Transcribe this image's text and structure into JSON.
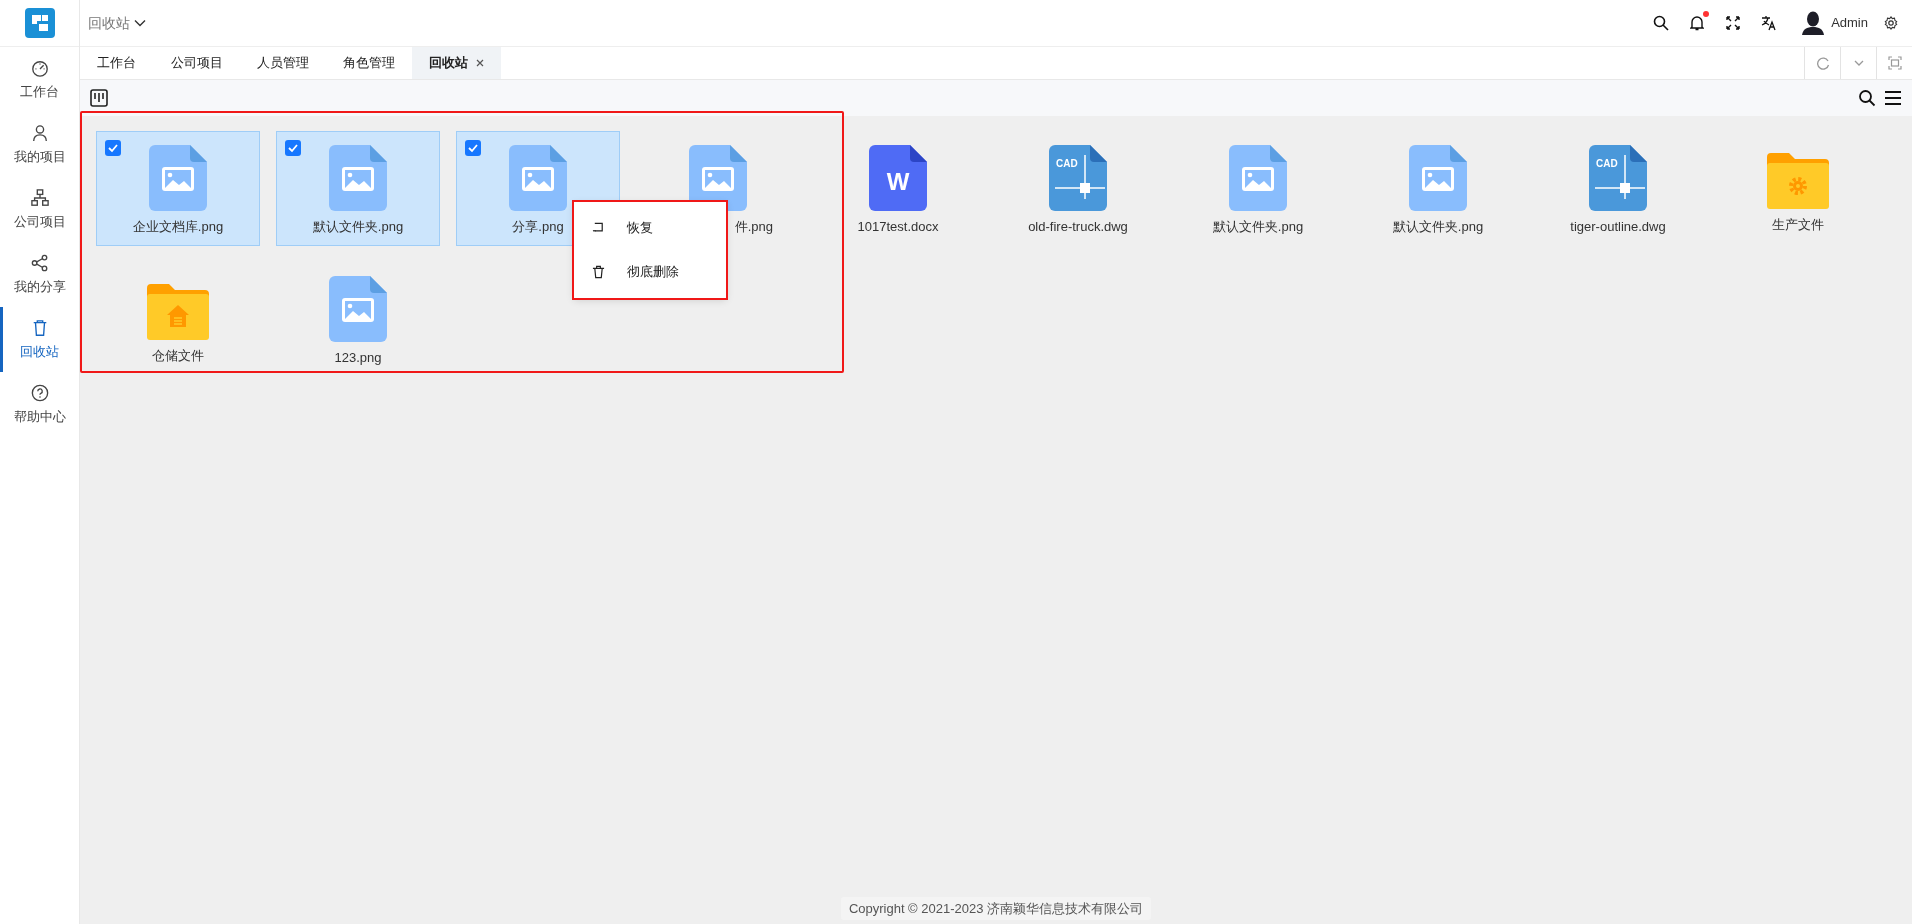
{
  "breadcrumb": {
    "label": "回收站"
  },
  "header": {
    "notification_dot": true,
    "user": "Admin"
  },
  "sidebar": {
    "items": [
      {
        "label": "工作台",
        "selected": false
      },
      {
        "label": "我的项目",
        "selected": false
      },
      {
        "label": "公司项目",
        "selected": false
      },
      {
        "label": "我的分享",
        "selected": false
      },
      {
        "label": "回收站",
        "selected": true
      },
      {
        "label": "帮助中心",
        "selected": false
      }
    ]
  },
  "tabs": [
    {
      "label": "工作台",
      "selected": false,
      "closable": false
    },
    {
      "label": "公司项目",
      "selected": false,
      "closable": false
    },
    {
      "label": "人员管理",
      "selected": false,
      "closable": false
    },
    {
      "label": "角色管理",
      "selected": false,
      "closable": false
    },
    {
      "label": "回收站",
      "selected": true,
      "closable": true
    }
  ],
  "files": {
    "highlighted": true,
    "items": [
      {
        "name": "企业文档库.png",
        "kind": "image",
        "selected": true
      },
      {
        "name": "默认文件夹.png",
        "kind": "image",
        "selected": true
      },
      {
        "name": "分享.png",
        "kind": "image",
        "selected": true
      },
      {
        "name": "件.png",
        "kind": "image",
        "selected": false,
        "covered": true
      },
      {
        "name": "1017test.docx",
        "kind": "word",
        "icon_text": "W",
        "selected": false
      },
      {
        "name": "old-fire-truck.dwg",
        "kind": "cad",
        "icon_text": "CAD",
        "selected": false
      },
      {
        "name": "默认文件夹.png",
        "kind": "image",
        "selected": false
      },
      {
        "name": "默认文件夹.png",
        "kind": "image",
        "selected": false
      },
      {
        "name": "tiger-outline.dwg",
        "kind": "cad",
        "icon_text": "CAD",
        "selected": false
      },
      {
        "name": "生产文件",
        "kind": "folder_gear",
        "selected": false
      },
      {
        "name": "仓储文件",
        "kind": "folder_house",
        "selected": false
      },
      {
        "name": "123.png",
        "kind": "image",
        "selected": false
      }
    ]
  },
  "context_menu": {
    "highlighted": true,
    "items": [
      {
        "label": "恢复"
      },
      {
        "label": "彻底删除"
      }
    ]
  },
  "footer": {
    "copyright": "Copyright © 2021-2023 济南颖华信息技术有限公司"
  }
}
